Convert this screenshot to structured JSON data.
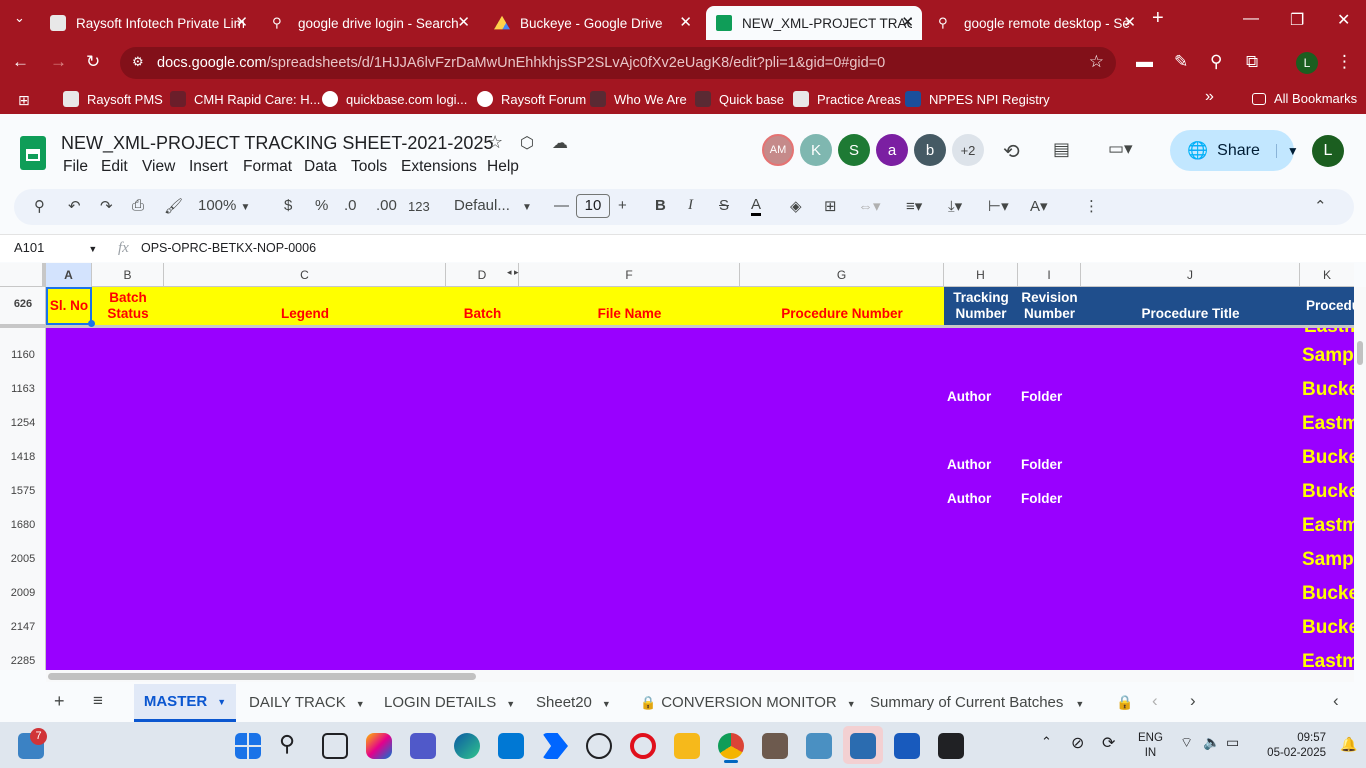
{
  "browser": {
    "tabs": [
      {
        "label": "Raysoft Infotech Private Lim",
        "icon": "raysoft-favicon"
      },
      {
        "label": "google drive login - Search",
        "icon": "search-icon"
      },
      {
        "label": "Buckeye - Google Drive",
        "icon": "google-drive-icon"
      },
      {
        "label": "NEW_XML-PROJECT TRACKI",
        "icon": "google-sheets-icon",
        "active": true
      },
      {
        "label": "google remote desktop - Se",
        "icon": "search-icon"
      }
    ],
    "url_domain": "docs.google.com",
    "url_path": "/spreadsheets/d/1HJJA6lvFzrDaMwUnEhhkhjsSP2SLvAjc0fXv2eUagK8/edit?pli=1&gid=0#gid=0",
    "bookmarks": [
      "Raysoft PMS",
      "CMH Rapid Care: H...",
      "quickbase.com logi...",
      "Raysoft Forum",
      "Who We Are",
      "Quick base",
      "Practice Areas",
      "NPPES NPI Registry"
    ],
    "all_bookmarks": "All Bookmarks",
    "more": "»",
    "profile_letter": "L"
  },
  "sheets": {
    "title": "NEW_XML-PROJECT TRACKING SHEET-2021-2025",
    "menus": [
      "File",
      "Edit",
      "View",
      "Insert",
      "Format",
      "Data",
      "Tools",
      "Extensions",
      "Help"
    ],
    "avatars": [
      {
        "label": "AM",
        "color": "#c58a8a"
      },
      {
        "label": "K",
        "color": "#7fb7b0"
      },
      {
        "label": "S",
        "color": "#1e7a34"
      },
      {
        "label": "a",
        "color": "#7b1fa2"
      },
      {
        "label": "b",
        "color": "#455a64"
      },
      {
        "label": "+2",
        "color": "#dde3ea"
      }
    ],
    "share_label": "Share",
    "user_letter": "L",
    "toolbar": {
      "zoom": "100%",
      "currency": "$",
      "percent": "%",
      "dec_decrease": ".0",
      "dec_increase": ".00",
      "number_format": "123",
      "font": "Defaul...",
      "font_size": "10",
      "bold": "B",
      "italic": "I",
      "strike": "S",
      "text_color": "A",
      "more": "⋮"
    },
    "name_box": "A101",
    "formula_label": "fx",
    "formula": "OPS-OPRC-BETKX-NOP-0006",
    "columns": [
      "A",
      "B",
      "C",
      "D",
      "F",
      "G",
      "H",
      "I",
      "J",
      "K"
    ],
    "header_row_number": "626",
    "header_cells": [
      {
        "col": "A",
        "text": "Sl. No"
      },
      {
        "col": "B",
        "text": "Batch Status"
      },
      {
        "col": "C",
        "text": "Legend"
      },
      {
        "col": "D",
        "text": "Batch"
      },
      {
        "col": "F",
        "text": "File Name"
      },
      {
        "col": "G",
        "text": "Procedure Number"
      },
      {
        "col": "H",
        "text": "Tracking Number"
      },
      {
        "col": "I",
        "text": "Revision Number"
      },
      {
        "col": "J",
        "text": "Procedure Title"
      },
      {
        "col": "K",
        "text": "Procedu Type"
      }
    ],
    "rows": [
      {
        "num": "1160",
        "h": "",
        "i": "",
        "k": "Samp"
      },
      {
        "num": "1163",
        "h": "Author",
        "i": "Folder",
        "k": "Bucke"
      },
      {
        "num": "1254",
        "h": "",
        "i": "",
        "k": "Eastm"
      },
      {
        "num": "1418",
        "h": "Author",
        "i": "Folder",
        "k": "Bucke"
      },
      {
        "num": "1575",
        "h": "Author",
        "i": "Folder",
        "k": "Bucke"
      },
      {
        "num": "1680",
        "h": "",
        "i": "",
        "k": "Eastm"
      },
      {
        "num": "2005",
        "h": "",
        "i": "",
        "k": "Samp"
      },
      {
        "num": "2009",
        "h": "",
        "i": "",
        "k": "Bucke"
      },
      {
        "num": "2147",
        "h": "",
        "i": "",
        "k": "Bucke"
      },
      {
        "num": "2285",
        "h": "",
        "i": "",
        "k": "Eastm"
      }
    ],
    "sheet_tabs": [
      {
        "label": "MASTER",
        "active": true
      },
      {
        "label": "DAILY TRACK"
      },
      {
        "label": "LOGIN DETAILS"
      },
      {
        "label": "Sheet20"
      },
      {
        "label": "CONVERSION MONITOR",
        "locked": true
      },
      {
        "label": "Summary of Current Batches"
      }
    ]
  },
  "taskbar": {
    "weather_badge": "7",
    "lang_top": "ENG",
    "lang_bottom": "IN",
    "time": "09:57",
    "date": "05-02-2025"
  },
  "colors": {
    "browser_chrome": "#a31621",
    "header_yellow": "#ffff00",
    "header_red_text": "#ff0000",
    "header_blue": "#1f4e8c",
    "row_purple": "#9900ff",
    "cell_yellow_text": "#ffff00"
  }
}
